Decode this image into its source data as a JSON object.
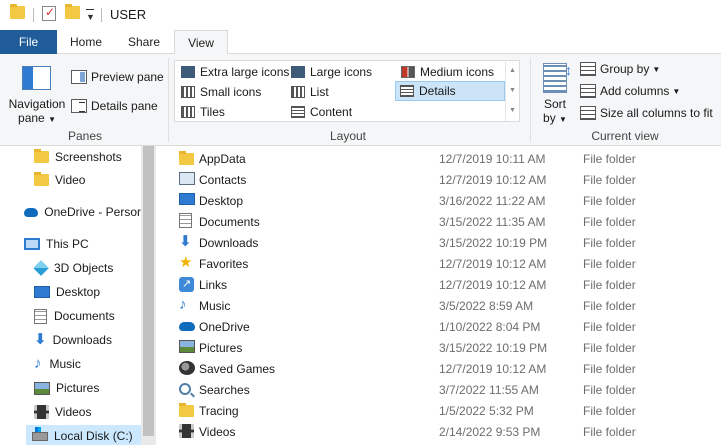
{
  "window": {
    "title": "USER"
  },
  "tabs": [
    {
      "label": "File"
    },
    {
      "label": "Home"
    },
    {
      "label": "Share"
    },
    {
      "label": "View"
    }
  ],
  "ribbon": {
    "panes": {
      "group_label": "Panes",
      "navigation_pane": "Navigation pane",
      "preview_pane": "Preview pane",
      "details_pane": "Details pane"
    },
    "layout": {
      "group_label": "Layout",
      "items": [
        "Extra large icons",
        "Large icons",
        "Medium icons",
        "Small icons",
        "List",
        "Details",
        "Tiles",
        "Content"
      ],
      "selected": "Details"
    },
    "current_view": {
      "group_label": "Current view",
      "sort_by": "Sort by",
      "group_by": "Group by",
      "add_columns": "Add columns",
      "size_all": "Size all columns to fit"
    }
  },
  "nav": {
    "items": [
      {
        "label": "Screenshots",
        "icon": "folder-icon"
      },
      {
        "label": "Video",
        "icon": "folder-icon"
      },
      {
        "label": "OneDrive - Persor",
        "icon": "onedrive-icon"
      },
      {
        "label": "This PC",
        "icon": "monitor-icon"
      },
      {
        "label": "3D Objects",
        "icon": "cube-icon"
      },
      {
        "label": "Desktop",
        "icon": "desktop-icon"
      },
      {
        "label": "Documents",
        "icon": "document-icon"
      },
      {
        "label": "Downloads",
        "icon": "download-icon"
      },
      {
        "label": "Music",
        "icon": "music-icon"
      },
      {
        "label": "Pictures",
        "icon": "pictures-icon"
      },
      {
        "label": "Videos",
        "icon": "videos-icon"
      },
      {
        "label": "Local Disk (C:)",
        "icon": "disk-icon"
      }
    ]
  },
  "files": [
    {
      "name": "AppData",
      "date": "12/7/2019 10:11 AM",
      "type": "File folder",
      "icon": "folder-icon"
    },
    {
      "name": "Contacts",
      "date": "12/7/2019 10:12 AM",
      "type": "File folder",
      "icon": "contacts-icon"
    },
    {
      "name": "Desktop",
      "date": "3/16/2022 11:22 AM",
      "type": "File folder",
      "icon": "desktop-icon"
    },
    {
      "name": "Documents",
      "date": "3/15/2022 11:35 AM",
      "type": "File folder",
      "icon": "document-icon"
    },
    {
      "name": "Downloads",
      "date": "3/15/2022 10:19 PM",
      "type": "File folder",
      "icon": "download-icon"
    },
    {
      "name": "Favorites",
      "date": "12/7/2019 10:12 AM",
      "type": "File folder",
      "icon": "star-icon"
    },
    {
      "name": "Links",
      "date": "12/7/2019 10:12 AM",
      "type": "File folder",
      "icon": "link-icon"
    },
    {
      "name": "Music",
      "date": "3/5/2022 8:59 AM",
      "type": "File folder",
      "icon": "music-icon"
    },
    {
      "name": "OneDrive",
      "date": "1/10/2022 8:04 PM",
      "type": "File folder",
      "icon": "onedrive-icon"
    },
    {
      "name": "Pictures",
      "date": "3/15/2022 10:19 PM",
      "type": "File folder",
      "icon": "pictures-icon"
    },
    {
      "name": "Saved Games",
      "date": "12/7/2019 10:12 AM",
      "type": "File folder",
      "icon": "saved-games-icon"
    },
    {
      "name": "Searches",
      "date": "3/7/2022 11:55 AM",
      "type": "File folder",
      "icon": "search-icon"
    },
    {
      "name": "Tracing",
      "date": "1/5/2022 5:32 PM",
      "type": "File folder",
      "icon": "folder-icon"
    },
    {
      "name": "Videos",
      "date": "2/14/2022 9:53 PM",
      "type": "File folder",
      "icon": "videos-icon"
    }
  ]
}
